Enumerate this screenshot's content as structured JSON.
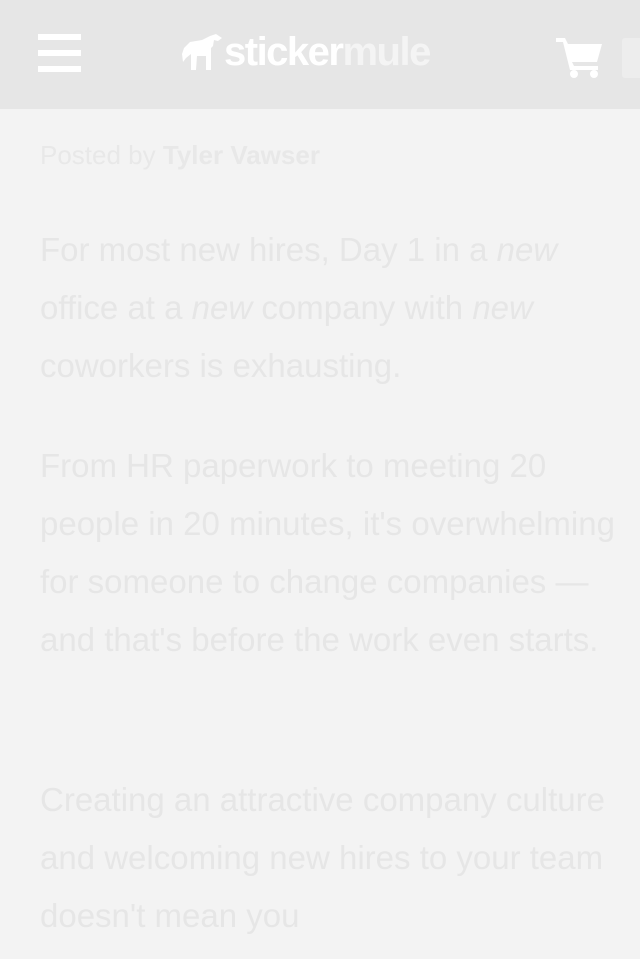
{
  "header": {
    "brand_part1": "sticker",
    "brand_part2": "mule",
    "menu_icon": "hamburger-menu-icon",
    "logo_icon": "mule-logo-icon",
    "cart_icon": "shopping-cart-icon"
  },
  "byline": {
    "prefix": "Posted by",
    "author": "Tyler Vawser"
  },
  "article": {
    "p1": {
      "a": "For most new hires, Day 1 in a",
      "em1": "new",
      "b": "office at a",
      "em2": "new",
      "c": "company with",
      "em3": "new",
      "d": "coworkers is exhausting."
    },
    "p2": "From HR paperwork to meeting 20 people in 20 minutes, it's overwhelming for someone to change companies — and that's before the work even starts.",
    "p3": "Creating an attractive company culture and welcoming new hires to your team doesn't mean you"
  },
  "colors": {
    "header_bg": "#e6e6e6",
    "page_bg": "#f3f3f3",
    "text": "#e6e6e6"
  }
}
